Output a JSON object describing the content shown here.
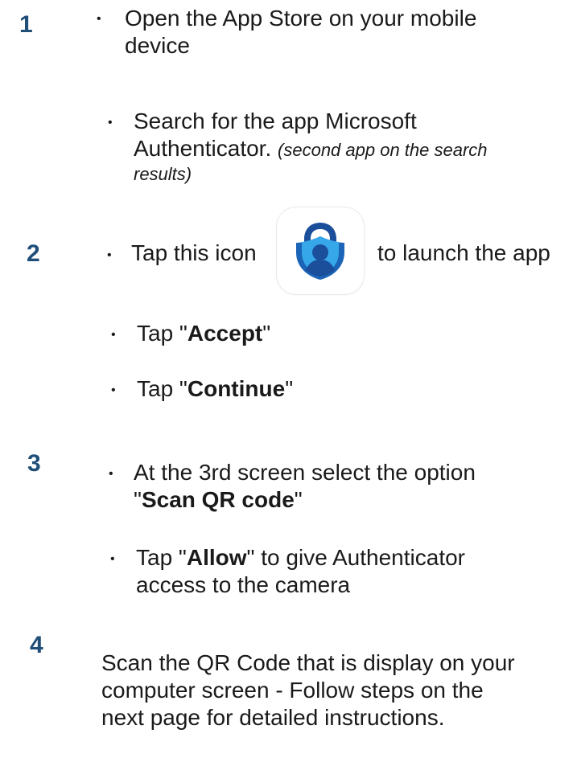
{
  "steps": [
    {
      "number": "1"
    },
    {
      "number": "2"
    },
    {
      "number": "3"
    },
    {
      "number": "4"
    }
  ],
  "bullet": "•",
  "items": {
    "open_store_line1": "Open the App Store on your mobile",
    "open_store_line2": "device",
    "search_line1": "Search for the app Microsoft",
    "search_line2": "Authenticator.",
    "search_note_part1": "(second app on the search",
    "search_note_part2": "results)",
    "tap_icon_before": "Tap this icon",
    "tap_icon_after": "to launch the app",
    "tap_prefix": "Tap \"",
    "accept": "Accept",
    "continue": "Continue",
    "quote_close": "\"",
    "third_screen_line1": "At the 3rd screen select the option",
    "scan_qr_open_quote": "\"",
    "scan_qr": "Scan QR code",
    "allow_prefix": "Tap \"",
    "allow": "Allow",
    "allow_suffix": "\" to give Authenticator",
    "allow_line2": "access to the camera",
    "scan_line1": "Scan the QR Code that is display on your",
    "scan_line2": "computer screen -  Follow steps on the",
    "scan_line3": "next page for detailed instructions."
  },
  "app_icon": {
    "icon_name": "microsoft-authenticator-icon",
    "colors": {
      "lock_dark": "#1b4f9c",
      "body_light": "#36a8ea",
      "person": "#8fd3f7"
    }
  },
  "colors": {
    "step_number": "#1f4e79",
    "text": "#1a1a1a"
  }
}
